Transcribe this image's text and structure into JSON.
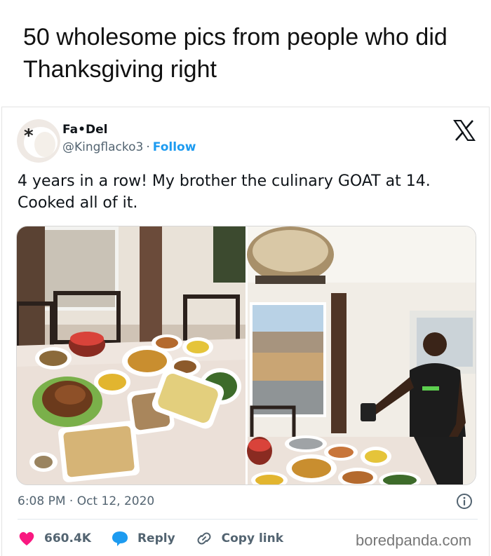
{
  "article": {
    "headline": "50 wholesome pics from people who did Thanksgiving right"
  },
  "tweet": {
    "author_name": "Fa•Del",
    "handle": "@Kingflacko3",
    "separator": "·",
    "follow_label": "Follow",
    "text": "4 years in a row! My brother the culinary GOAT at 14. Cooked all of it.",
    "timestamp": "6:08 PM · Oct 12, 2020",
    "likes": "660.4K",
    "reply_label": "Reply",
    "copy_link_label": "Copy link"
  },
  "media": {
    "left_photo": "thanksgiving-dinner-table",
    "right_photo": "boy-with-food-spread"
  },
  "icons": {
    "platform": "x-logo-icon",
    "info": "info-icon",
    "like": "heart-icon",
    "reply": "speech-bubble-icon",
    "copy": "link-icon"
  },
  "colors": {
    "like": "#f91880",
    "reply": "#1d9bf0",
    "follow": "#1d9bf0",
    "muted": "#536471"
  },
  "watermark": "boredpanda.com"
}
